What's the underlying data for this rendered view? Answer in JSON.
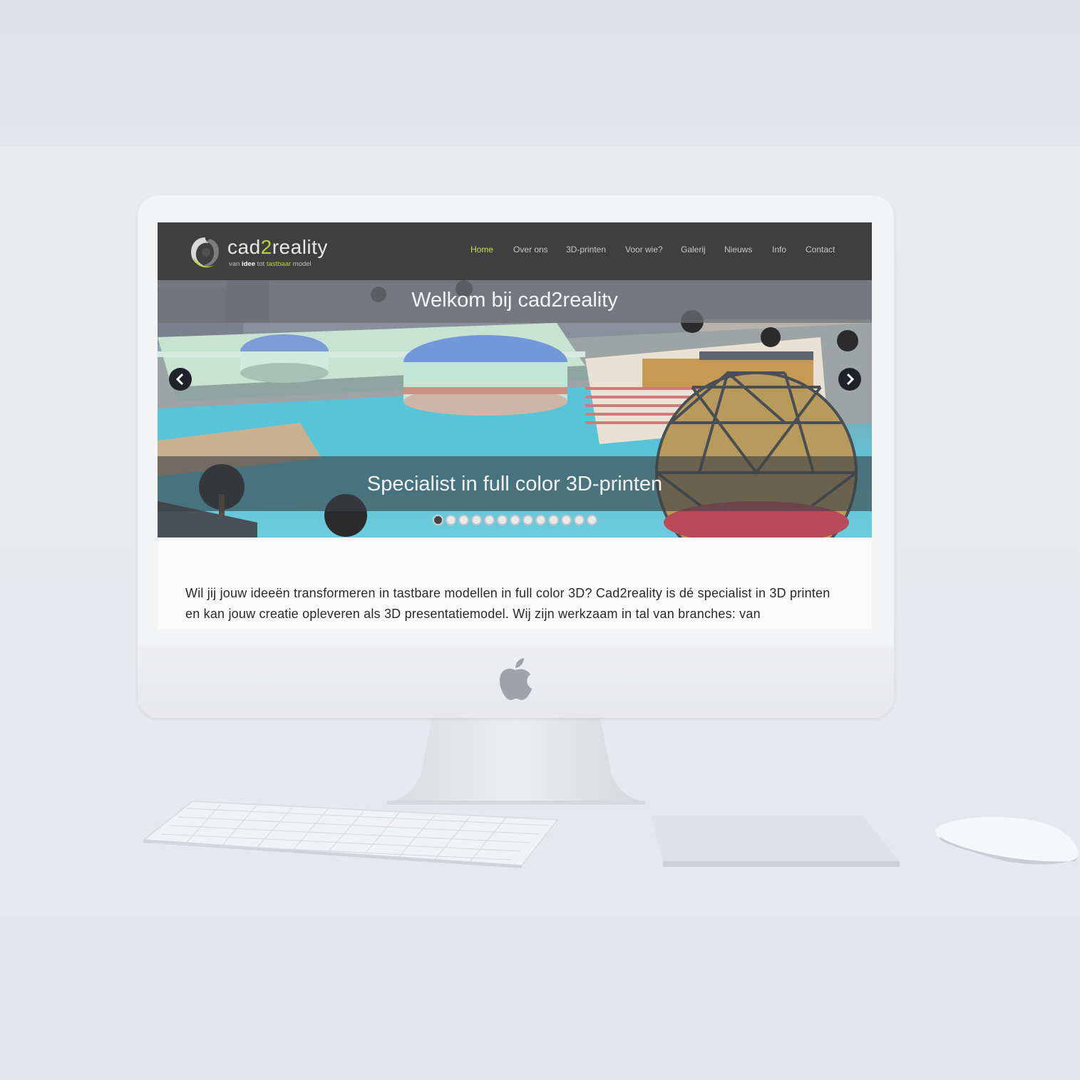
{
  "site": {
    "logo": {
      "word_main": "cad",
      "word_accent": "2",
      "word_end": "reality",
      "tagline_pre": "van ",
      "tagline_bold": "idee",
      "tagline_mid": " tot ",
      "tagline_accent": "tastbaar",
      "tagline_end": " model"
    },
    "nav": [
      {
        "label": "Home",
        "active": true
      },
      {
        "label": "Over ons",
        "active": false
      },
      {
        "label": "3D-printen",
        "active": false
      },
      {
        "label": "Voor wie?",
        "active": false
      },
      {
        "label": "Galerij",
        "active": false
      },
      {
        "label": "Nieuws",
        "active": false
      },
      {
        "label": "Info",
        "active": false
      },
      {
        "label": "Contact",
        "active": false
      }
    ],
    "hero": {
      "title": "Welkom bij cad2reality",
      "caption": "Specialist in full color 3D-printen",
      "slide_count": 13,
      "active_slide": 1
    },
    "intro_text": "Wil jij jouw ideeën transformeren in tastbare modellen in full color 3D? Cad2reality is dé specialist in 3D printen en kan jouw creatie opleveren als 3D presentatiemodel. Wij zijn werkzaam in tal van branches: van"
  },
  "colors": {
    "header_bg": "#3f3f3f",
    "nav_active": "#c8e04a",
    "brand_lime": "#b6d33c"
  }
}
